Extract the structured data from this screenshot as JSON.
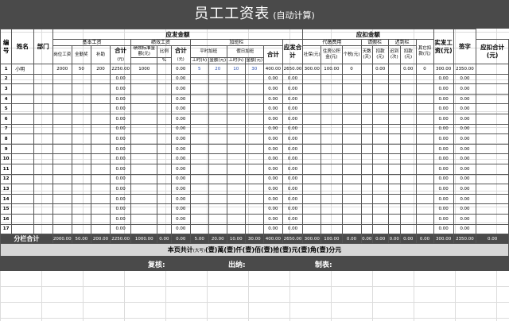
{
  "title": {
    "main": "员工工资表",
    "sub": "(自动计算)"
  },
  "headers": {
    "no": "编号",
    "name": "姓名",
    "dept": "部门",
    "payable": "应发金额",
    "deduct": "应扣金额",
    "basic": "基本工资",
    "perf": "绩效工资",
    "overtime": "加班栏",
    "post_wage": "岗位工资",
    "attendance": "全勤奖",
    "subsidy": "补助",
    "subtotal": "合计",
    "subtotal_unit": "(元)",
    "perf_amount": "绩效标准金额(元)",
    "ratio": "比例",
    "percent": "%",
    "weekday_ot": "平时加班",
    "holiday_ot": "假日加班",
    "hours": "工时(h)",
    "amount": "金额(元)",
    "payable_total": "应发合计",
    "withhold": "代缴费用",
    "leave": "请假栏",
    "late": "迟到栏",
    "social": "社保(元)",
    "housing": "住房公积金(元)",
    "tax": "个税(元)",
    "leave_days": "天数(天)",
    "deduct_amt": "扣款(元)",
    "late_times": "迟到(次)",
    "other": "其它扣款(元)",
    "deduct_total": "应扣合计(元)",
    "net": "实发工资(元)",
    "sign": "签字"
  },
  "row_numbers": [
    "1",
    "2",
    "3",
    "4",
    "5",
    "6",
    "7",
    "8",
    "9",
    "10",
    "11",
    "12",
    "13",
    "14",
    "15",
    "16",
    "17"
  ],
  "first_row": {
    "name": "小明",
    "post_wage": "2000",
    "attendance": "50",
    "subsidy": "200",
    "basic_total": "2250.00",
    "perf_amount": "1000",
    "perf_total": "0.00",
    "wd_hours": "5",
    "wd_amount": "20",
    "hd_hours": "10",
    "hd_amount": "30",
    "ot_total": "400.00",
    "payable_total": "2650.00",
    "social": "300.00",
    "housing": "100.00",
    "tax": "0",
    "leave_deduct": "0.00",
    "late_deduct": "0.00",
    "other": "0",
    "deduct_total": "300.00",
    "net": "2350.00"
  },
  "empty_value": "0.00",
  "totals": {
    "label": "分栏合计",
    "values": [
      "2000.00",
      "50.00",
      "200.00",
      "2250.00",
      "1000.00",
      "0.00",
      "0.00",
      "5.00",
      "20.00",
      "10.00",
      "30.00",
      "400.00",
      "2650.00",
      "300.00",
      "100.00",
      "0.00",
      "0.00",
      "0.00",
      "0.00",
      "0.00",
      "0.00",
      "300.00",
      "2350.00",
      "0.00"
    ]
  },
  "amount_words": {
    "prefix": "本页共计",
    "small": "(大写)",
    "value": "(壹)萬(壹)仟(壹)佰(壹)拾(壹)元(壹)角(壹)分元"
  },
  "footer": {
    "review": "复核:",
    "cashier": "出纳:",
    "maker": "制表:"
  }
}
